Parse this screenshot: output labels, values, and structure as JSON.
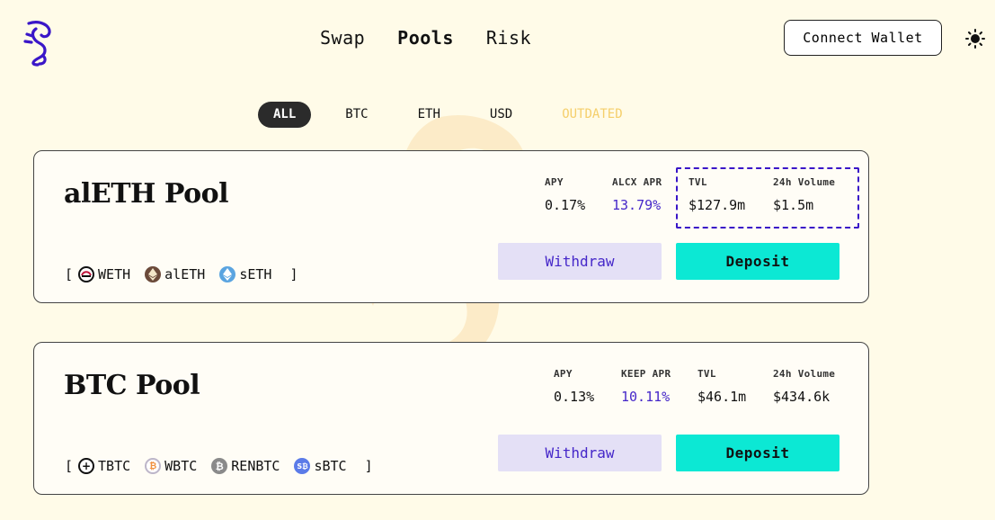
{
  "nav": {
    "items": [
      {
        "label": "Swap"
      },
      {
        "label": "Pools"
      },
      {
        "label": "Risk"
      }
    ]
  },
  "header": {
    "connect_wallet": "Connect Wallet"
  },
  "filters": [
    {
      "label": "ALL"
    },
    {
      "label": "BTC"
    },
    {
      "label": "ETH"
    },
    {
      "label": "USD"
    },
    {
      "label": "OUTDATED"
    }
  ],
  "pools": [
    {
      "name": "alETH Pool",
      "tokens": [
        {
          "symbol": "WETH",
          "icon": "weth-icon"
        },
        {
          "symbol": "alETH",
          "icon": "aleth-icon"
        },
        {
          "symbol": "sETH",
          "icon": "seth-icon"
        }
      ],
      "stats": [
        {
          "label": "APY",
          "value": "0.17%"
        },
        {
          "label": "ALCX APR",
          "value": "13.79%"
        },
        {
          "label": "TVL",
          "value": "$127.9m"
        },
        {
          "label": "24h Volume",
          "value": "$1.5m"
        }
      ],
      "withdraw": "Withdraw",
      "deposit": "Deposit"
    },
    {
      "name": "BTC Pool",
      "tokens": [
        {
          "symbol": "TBTC",
          "icon": "tbtc-icon"
        },
        {
          "symbol": "WBTC",
          "icon": "wbtc-icon"
        },
        {
          "symbol": "RENBTC",
          "icon": "renbtc-icon"
        },
        {
          "symbol": "sBTC",
          "icon": "sbtc-icon"
        }
      ],
      "stats": [
        {
          "label": "APY",
          "value": "0.13%"
        },
        {
          "label": "KEEP APR",
          "value": "10.11%"
        },
        {
          "label": "TVL",
          "value": "$46.1m"
        },
        {
          "label": "24h Volume",
          "value": "$434.6k"
        }
      ],
      "withdraw": "Withdraw",
      "deposit": "Deposit"
    }
  ],
  "brackets": {
    "open": "[",
    "close": "]"
  },
  "colors": {
    "background": "#fffbe8",
    "accent": "#4527c9",
    "deposit": "#0ce8d4",
    "withdraw_bg": "#e4e0f6",
    "outdated": "#f5cf6b"
  }
}
